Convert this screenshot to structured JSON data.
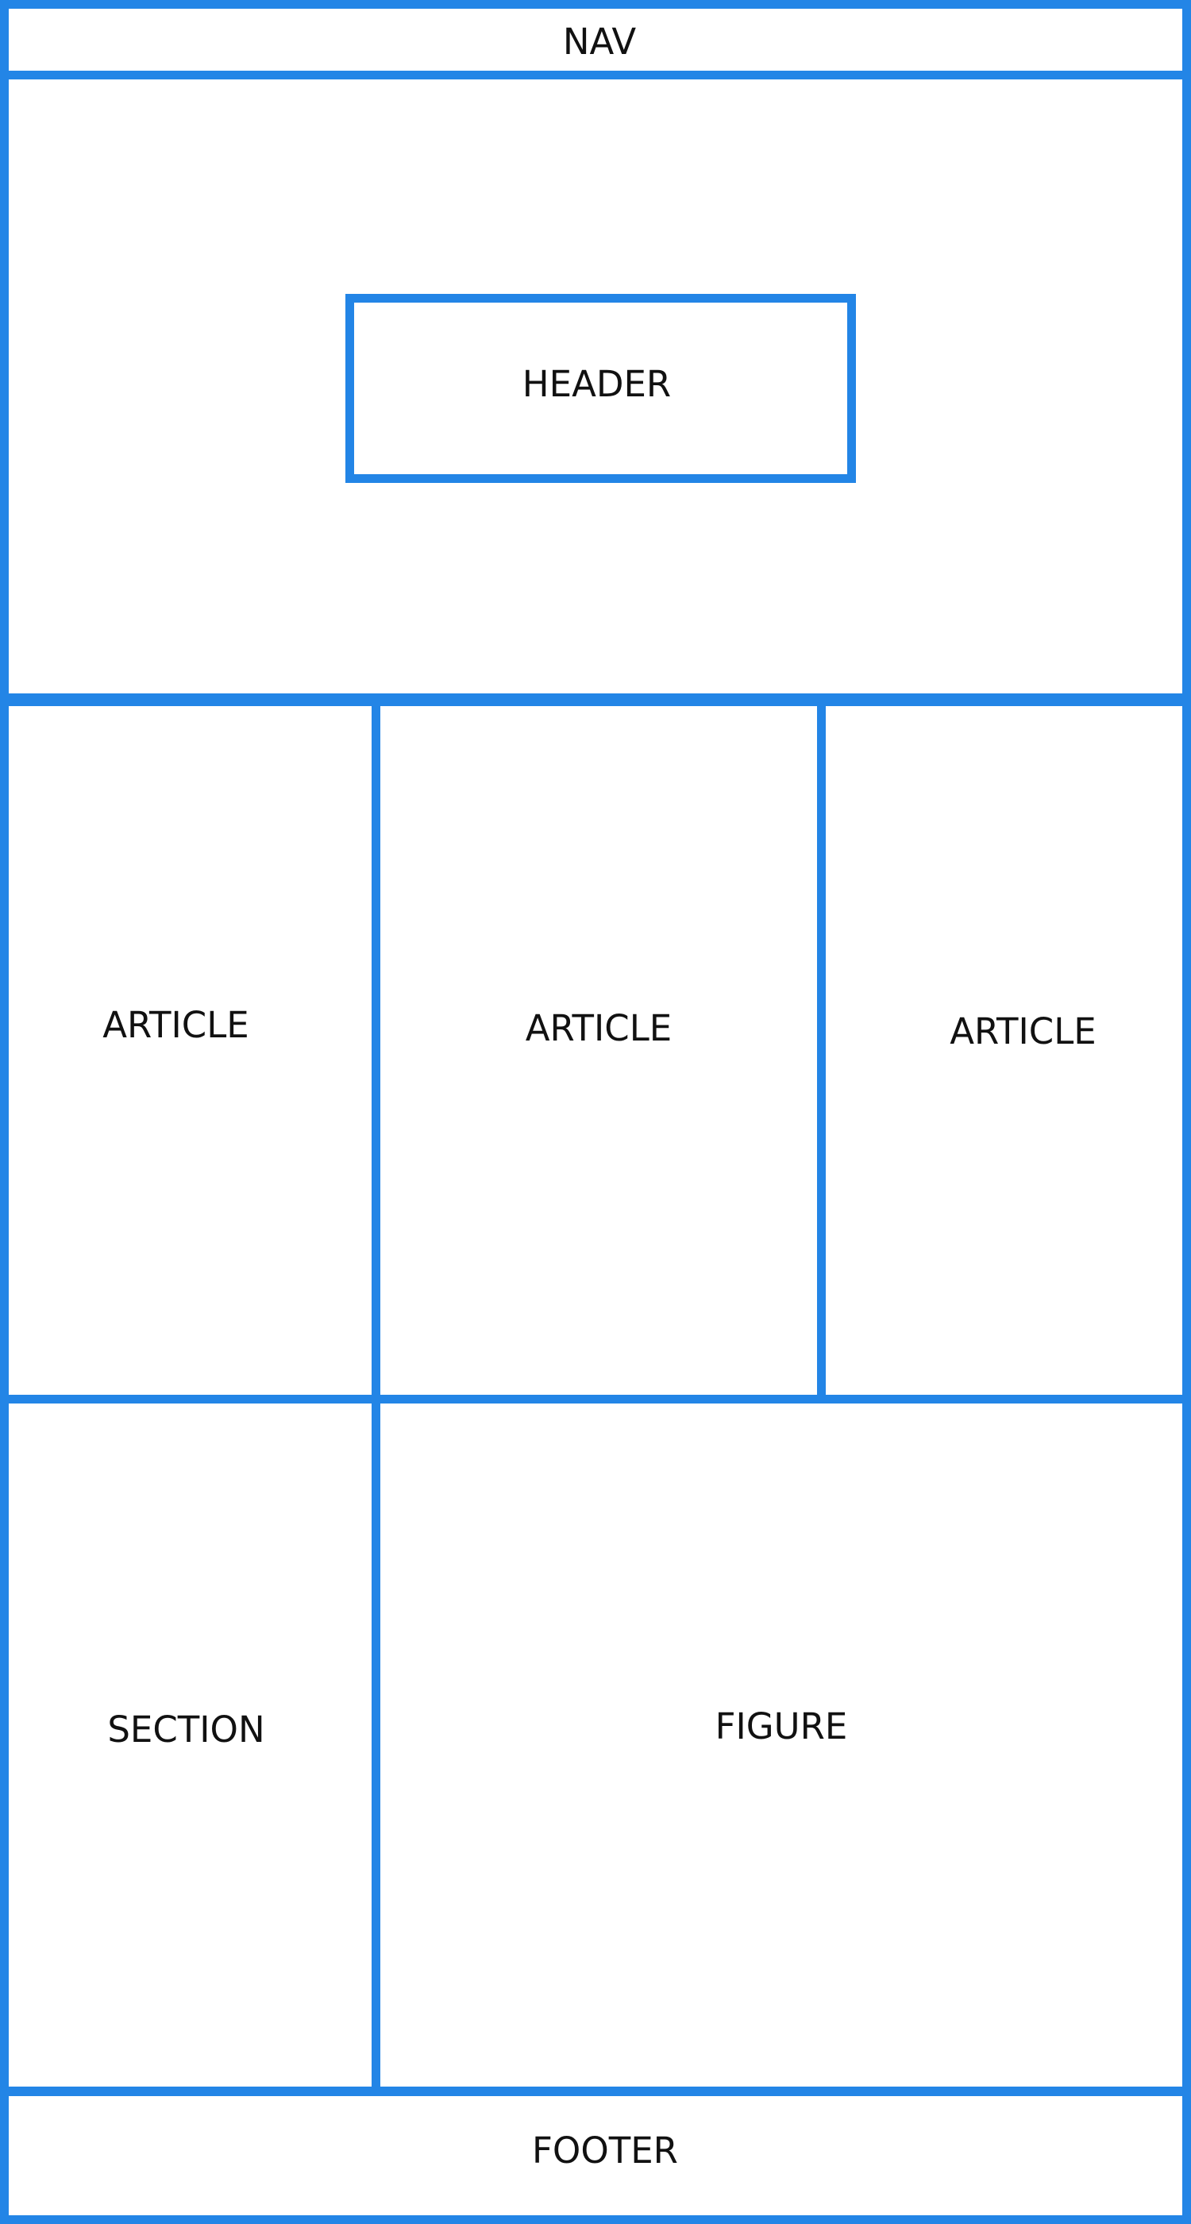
{
  "layout": {
    "nav": {
      "label": "NAV"
    },
    "header": {
      "label": "HEADER"
    },
    "articles": [
      {
        "label": "ARTICLE"
      },
      {
        "label": "ARTICLE"
      },
      {
        "label": "ARTICLE"
      }
    ],
    "section": {
      "label": "SECTION"
    },
    "figure": {
      "label": "FIGURE"
    },
    "footer": {
      "label": "FOOTER"
    }
  },
  "colors": {
    "border": "#2385e6",
    "text": "#111111",
    "background": "#ffffff"
  }
}
